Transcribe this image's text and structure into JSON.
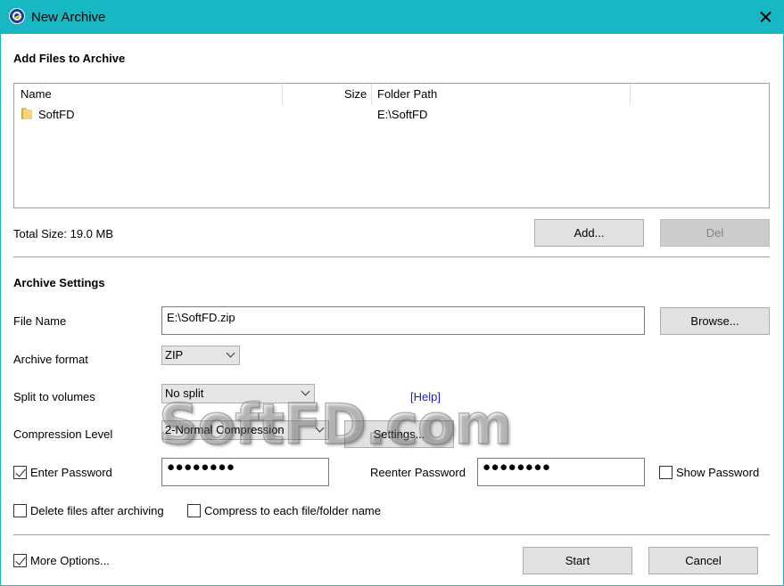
{
  "window": {
    "title": "New Archive"
  },
  "add_section": {
    "heading": "Add Files to Archive",
    "columns": [
      "Name",
      "Size",
      "Folder Path"
    ],
    "rows": [
      {
        "name": "SoftFD",
        "size": "",
        "path": "E:\\SoftFD"
      }
    ],
    "total_size": "Total Size: 19.0 MB",
    "add_label": "Add...",
    "del_label": "Del"
  },
  "settings": {
    "heading": "Archive Settings",
    "file_name_label": "File Name",
    "file_name_value": "E:\\SoftFD.zip",
    "browse_label": "Browse...",
    "format_label": "Archive format",
    "format_value": "ZIP",
    "split_label": "Split to volumes",
    "split_value": "No split",
    "help_link": "[Help]",
    "compression_label": "Compression Level",
    "compression_value": "2-Normal Compression",
    "compression_settings_label": "Settings...",
    "enter_password_label": "Enter Password",
    "enter_password_checked": true,
    "password_mask": "●●●●●●●●",
    "reenter_password_label": "Reenter Password",
    "reenter_password_mask": "●●●●●●●●",
    "show_password_label": "Show Password",
    "show_password_checked": false,
    "delete_after_label": "Delete files after archiving",
    "delete_after_checked": false,
    "compress_each_label": "Compress to each file/folder name",
    "compress_each_checked": false
  },
  "footer": {
    "more_options_label": "More Options...",
    "more_options_checked": true,
    "start_label": "Start",
    "cancel_label": "Cancel"
  },
  "watermark": "SoftFD.com",
  "colors": {
    "titlebar": "#17b8c4",
    "link": "#1b1bd6"
  }
}
